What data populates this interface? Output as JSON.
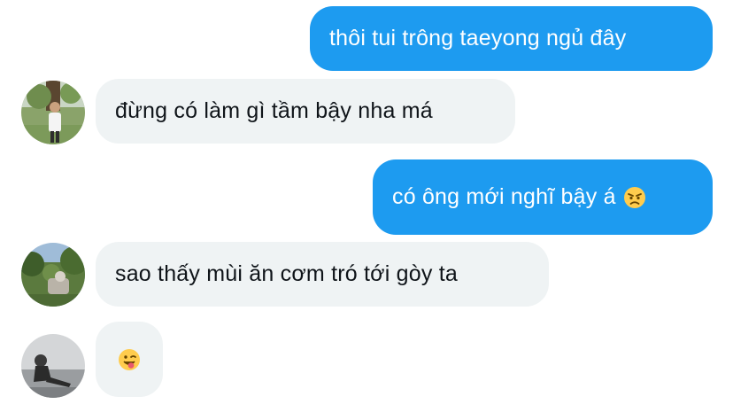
{
  "conversation": {
    "messages": [
      {
        "side": "outgoing",
        "text": "thôi tui trông taeyong ngủ đây"
      },
      {
        "side": "incoming",
        "text": "đừng có làm gì tầm bậy nha má",
        "avatar": "avatar-person-standing-icon"
      },
      {
        "side": "outgoing",
        "text": "có ông mới nghĩ bậy á",
        "emoji": "angry-face-emoji-icon"
      },
      {
        "side": "incoming",
        "text": "sao thấy mùi ăn cơm tró tới gòy ta",
        "avatar": "avatar-garden-icon"
      },
      {
        "side": "incoming",
        "text": "",
        "emoji": "winking-tongue-face-emoji-icon",
        "avatar": "avatar-person-sitting-icon"
      }
    ]
  },
  "colors": {
    "outgoing_bubble": "#1d9bf0",
    "incoming_bubble": "#eff3f4",
    "outgoing_text": "#ffffff",
    "incoming_text": "#0f1419"
  }
}
